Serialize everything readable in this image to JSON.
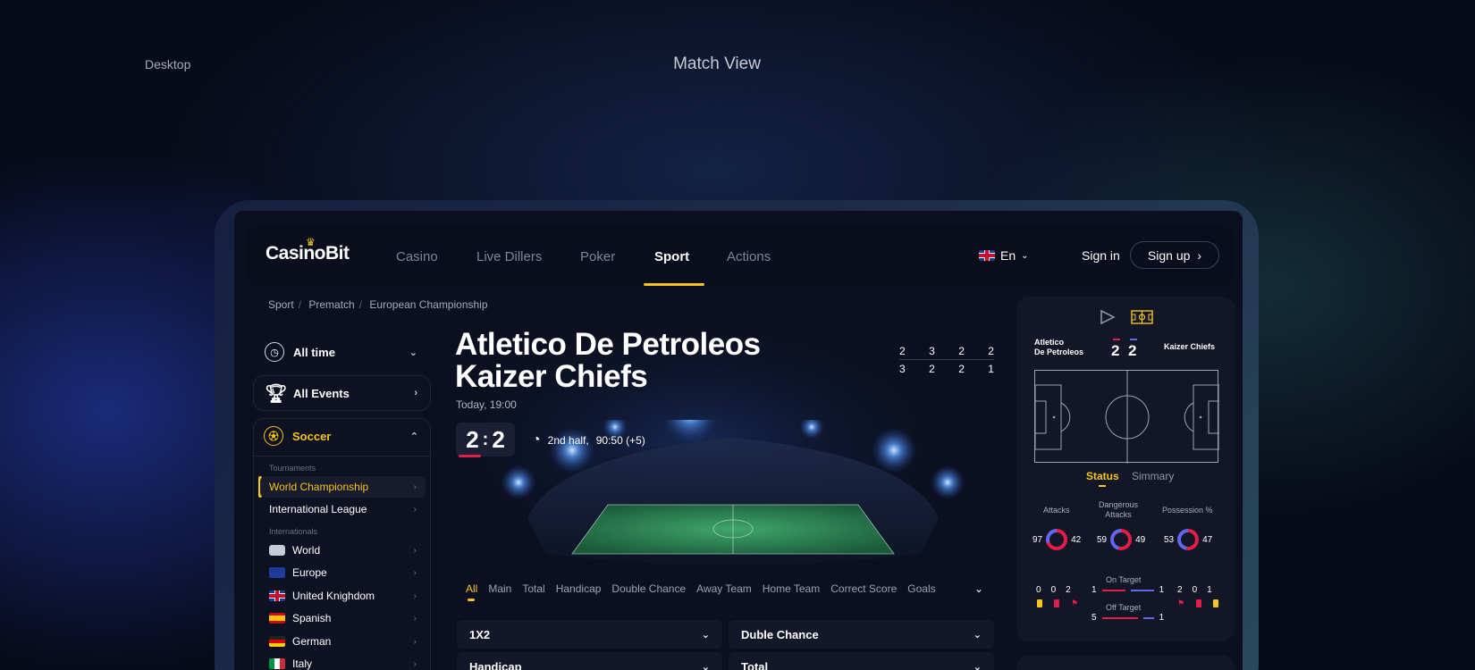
{
  "page": {
    "left_label": "Desktop",
    "title": "Match View"
  },
  "header": {
    "logo": "CasinoBit",
    "nav": [
      {
        "label": "Casino"
      },
      {
        "label": "Live Dillers"
      },
      {
        "label": "Poker"
      },
      {
        "label": "Sport",
        "active": true
      },
      {
        "label": "Actions"
      }
    ],
    "language": "En",
    "sign_in": "Sign in",
    "sign_up": "Sign up"
  },
  "breadcrumb": [
    "Sport",
    "Prematch",
    "European Championship"
  ],
  "sidebar": {
    "filters": [
      {
        "label": "All time",
        "icon": "clock-icon"
      },
      {
        "label": "All Events",
        "icon": "trophy-icon"
      }
    ],
    "sport": {
      "label": "Soccer",
      "icon": "soccer-ball-icon"
    },
    "tournaments_heading": "Tournaments",
    "tournaments": [
      {
        "label": "World Championship",
        "active": true
      },
      {
        "label": "International League"
      }
    ],
    "internationals_heading": "Internationals",
    "internationals": [
      {
        "label": "World",
        "flag": "world"
      },
      {
        "label": "Europe",
        "flag": "eu"
      },
      {
        "label": "United Knighdom",
        "flag": "uk"
      },
      {
        "label": "Spanish",
        "flag": "es"
      },
      {
        "label": "German",
        "flag": "de"
      },
      {
        "label": "Italy",
        "flag": "it"
      }
    ]
  },
  "match": {
    "team_home": "Atletico De Petroleos",
    "team_away": "Kaizer Chiefs",
    "date": "Today, 19:00",
    "score_home": "2",
    "score_sep": ":",
    "score_away": "2",
    "period": "2nd half,",
    "clock": "90:50 (+5)",
    "periods_home": [
      "2",
      "3",
      "2",
      "2"
    ],
    "periods_away": [
      "3",
      "2",
      "2",
      "1"
    ]
  },
  "market_tabs": [
    "All",
    "Main",
    "Total",
    "Handicap",
    "Double Chance",
    "Away Team",
    "Home Team",
    "Correct Score",
    "Goals"
  ],
  "markets": [
    "1X2",
    "Duble Chance",
    "Handicap",
    "Total"
  ],
  "live_panel": {
    "home_line1": "Atletico",
    "home_line2": "De Petroleos",
    "away": "Kaizer Chiefs",
    "score_home": "2",
    "score_away": "2",
    "tabs": [
      "Status",
      "Simmary"
    ],
    "stats": [
      {
        "label": "Attacks",
        "home": "97",
        "away": "42",
        "home_value": 97,
        "away_value": 42
      },
      {
        "label_line1": "Dangerous",
        "label_line2": "Attacks",
        "home": "59",
        "away": "49",
        "home_value": 59,
        "away_value": 49
      },
      {
        "label": "Possession %",
        "home": "53",
        "away": "47",
        "home_value": 53,
        "away_value": 47
      }
    ],
    "cards_home": [
      "0",
      "0",
      "2"
    ],
    "cards_away": [
      "2",
      "0",
      "1"
    ],
    "on_target": {
      "label": "On Target",
      "home": "1",
      "away": "1"
    },
    "off_target": {
      "label": "Off Target",
      "home": "5",
      "away": "1"
    }
  },
  "colors": {
    "accent": "#f5c518",
    "home": "#e11d48",
    "away": "#6366f1"
  }
}
